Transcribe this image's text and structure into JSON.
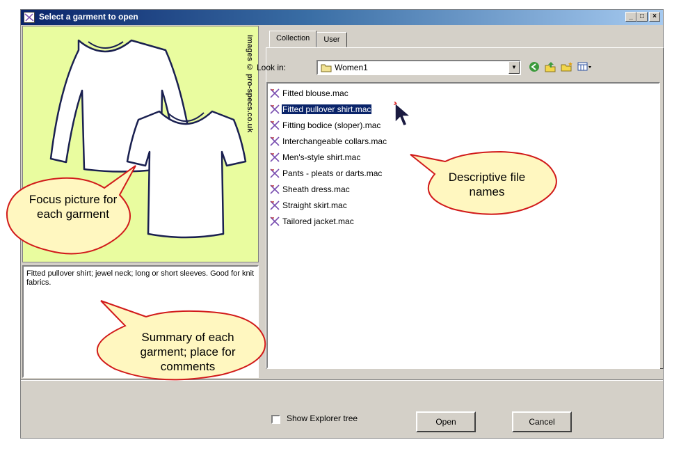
{
  "window": {
    "title": "Select a garment to open"
  },
  "title_buttons": {
    "minimize": "_",
    "maximize": "□",
    "close": "×"
  },
  "left": {
    "picture_credit": "images © pro-specs.co.uk",
    "summary_text": "Fitted pullover shirt; jewel neck; long or short sleeves.  Good for knit fabrics."
  },
  "tabs": [
    {
      "label": "Collection",
      "active": true
    },
    {
      "label": "User",
      "active": false
    }
  ],
  "lookin": {
    "label": "Look in:",
    "value": "Women1"
  },
  "files": [
    {
      "name": "Fitted blouse.mac",
      "selected": false
    },
    {
      "name": "Fitted pullover shirt.mac",
      "selected": true
    },
    {
      "name": "Fitting bodice (sloper).mac",
      "selected": false
    },
    {
      "name": "Interchangeable collars.mac",
      "selected": false
    },
    {
      "name": "Men's-style shirt.mac",
      "selected": false
    },
    {
      "name": "Pants - pleats or darts.mac",
      "selected": false
    },
    {
      "name": "Sheath dress.mac",
      "selected": false
    },
    {
      "name": "Straight skirt.mac",
      "selected": false
    },
    {
      "name": "Tailored jacket.mac",
      "selected": false
    }
  ],
  "footer": {
    "show_tree_label": "Show Explorer tree",
    "show_tree_checked": false,
    "open_label": "Open",
    "cancel_label": "Cancel"
  },
  "callouts": {
    "focus": "Focus picture for each garment",
    "names": "Descriptive file names",
    "summary": "Summary of each garment; place for comments"
  },
  "colors": {
    "title_gradient_start": "#0a246a",
    "picture_bg": "#e9fc9f",
    "callout_fill": "#fff7c0",
    "callout_stroke": "#d11a1a",
    "selection": "#0a246a"
  }
}
